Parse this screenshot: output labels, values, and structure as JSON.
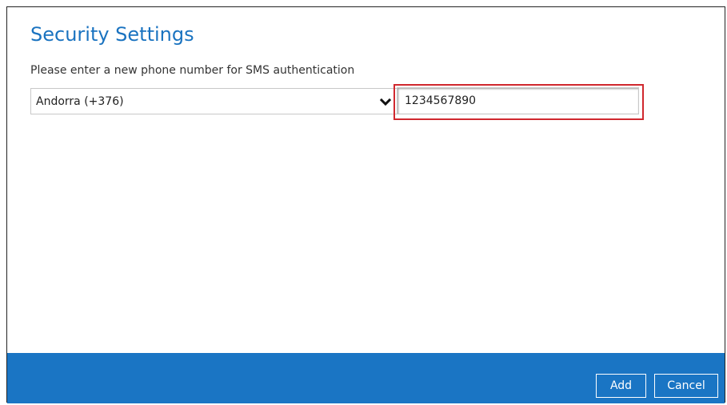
{
  "dialog": {
    "title": "Security Settings",
    "instruction": "Please enter a new phone number for SMS authentication"
  },
  "phone": {
    "country_selected": "Andorra (+376)",
    "number_value": "1234567890"
  },
  "footer": {
    "add_label": "Add",
    "cancel_label": "Cancel"
  },
  "colors": {
    "title": "#1a73c0",
    "footer": "#1a75c4",
    "highlight": "#d0282e"
  },
  "icons": {
    "select_arrow": "chevron-down-icon"
  }
}
